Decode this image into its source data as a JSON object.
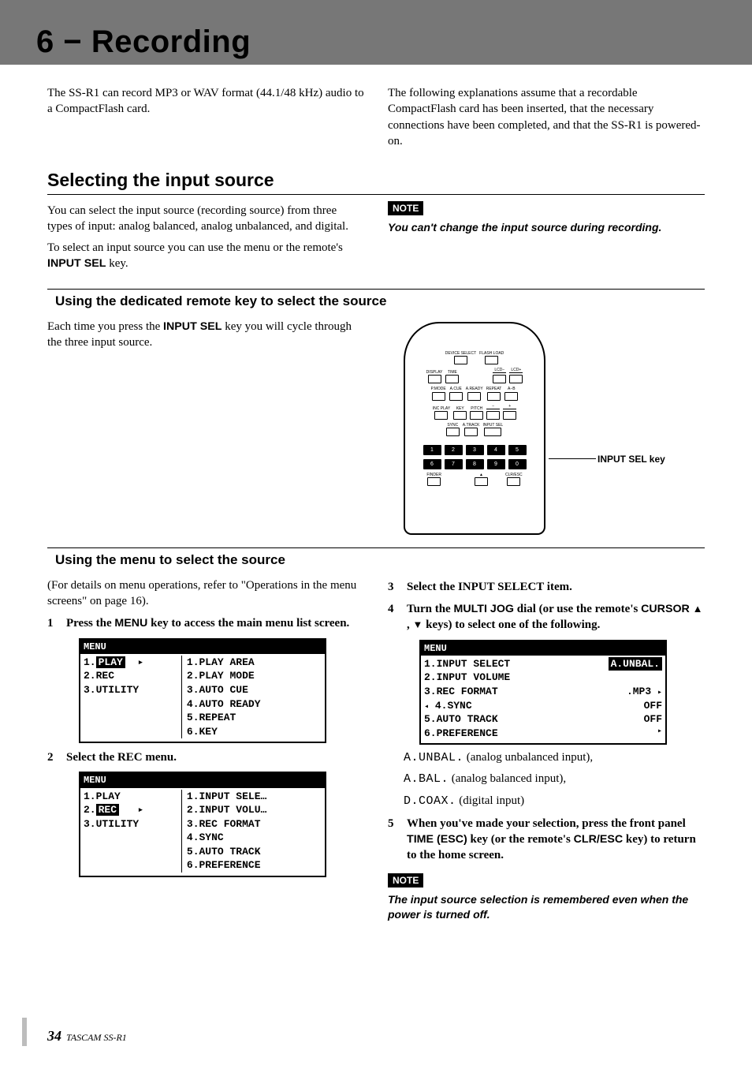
{
  "header": {
    "chapter_title": "6 − Recording"
  },
  "intro": {
    "left": "The SS-R1 can record MP3 or WAV format (44.1/48 kHz) audio to a CompactFlash card.",
    "right": "The following explanations assume that a recordable CompactFlash card has been inserted, that the necessary connections have been completed, and that the SS-R1 is powered-on."
  },
  "section1": {
    "title": "Selecting the input source",
    "p1": "You can select the input source (recording source) from three types of input: analog balanced, analog unbalanced, and digital.",
    "p2_a": "To select an input source you can use the menu or the remote's ",
    "p2_key": "INPUT SEL",
    "p2_b": " key.",
    "note_label": "NOTE",
    "note_text": "You can't change the input source during recording."
  },
  "sub1": {
    "title": "Using the dedicated remote key to select the source",
    "p1_a": "Each time you press the ",
    "p1_key": "INPUT SEL",
    "p1_b": " key you will cycle through the three input source.",
    "remote_callout": "INPUT SEL key",
    "remote_labels": {
      "r1": [
        "DEVICE SELECT",
        "FLASH LOAD"
      ],
      "r2": [
        "DISPLAY",
        "TIME",
        "",
        "LCD−",
        "LCD+"
      ],
      "r3": [
        "P.MODE",
        "A.CUE",
        "A.READY",
        "REPEAT",
        "A−B"
      ],
      "r4": [
        "INC PLAY",
        "KEY",
        "PITCH",
        "−",
        "+"
      ],
      "r5": [
        "SYNC",
        "A.TRACK",
        "INPUT SEL"
      ],
      "nums": [
        "1",
        "2",
        "3",
        "4",
        "5",
        "6",
        "7",
        "8",
        "9",
        "0"
      ],
      "bottom": [
        "FINDER",
        "",
        "",
        "",
        "CLR/ESC"
      ]
    }
  },
  "sub2": {
    "title": "Using the menu to select the source",
    "intro": "(For details on menu operations, refer to \"Operations in the menu screens\" on page 16).",
    "step1_a": "Press the ",
    "step1_key": "MENU",
    "step1_b": " key to access the main menu list screen.",
    "menu1": {
      "header": "MENU",
      "left": [
        "1.PLAY",
        "2.REC",
        "3.UTILITY"
      ],
      "left_selected_index": 0,
      "right": [
        "1.PLAY AREA",
        "2.PLAY MODE",
        "3.AUTO CUE",
        "4.AUTO READY",
        "5.REPEAT",
        "6.KEY"
      ]
    },
    "step2": "Select the REC menu.",
    "menu2": {
      "header": "MENU",
      "left": [
        "1.PLAY",
        "2.REC",
        "3.UTILITY"
      ],
      "left_selected_index": 1,
      "right": [
        "1.INPUT SELE…",
        "2.INPUT VOLU…",
        "3.REC FORMAT",
        "4.SYNC",
        "5.AUTO TRACK",
        "6.PREFERENCE"
      ]
    },
    "step3": "Select the INPUT SELECT item.",
    "step4_a": "Turn the ",
    "step4_key1": "MULTI JOG",
    "step4_b": " dial (or use the remote's ",
    "step4_key2": "CURSOR",
    "step4_c": "  ,   keys) to select one of the following.",
    "step4_up": "▲",
    "step4_dn": "▼",
    "menu3": {
      "header": "MENU",
      "items": [
        {
          "l": "1.INPUT SELECT",
          "r": "A.UNBAL.",
          "inv": true
        },
        {
          "l": "2.INPUT VOLUME",
          "r": ""
        },
        {
          "l": "3.REC FORMAT",
          "r": ".MP3"
        },
        {
          "l": "4.SYNC",
          "r": "OFF"
        },
        {
          "l": "5.AUTO TRACK",
          "r": "OFF"
        },
        {
          "l": "6.PREFERENCE",
          "r": ""
        }
      ]
    },
    "opts": {
      "o1_code": "A.UNBAL.",
      "o1_txt": " (analog unbalanced input),",
      "o2_code": "A.BAL.",
      "o2_txt": " (analog balanced input),",
      "o3_code": "D.COAX.",
      "o3_txt": " (digital input)"
    },
    "step5_a": "When you've made your selection, press the front panel ",
    "step5_key1": "TIME (ESC)",
    "step5_b": " key (or the remote's ",
    "step5_key2": "CLR/ESC",
    "step5_c": " key) to return to the home screen.",
    "note_label": "NOTE",
    "note_text": "The input source selection is remembered even when the power is turned off."
  },
  "footer": {
    "page": "34",
    "model": "TASCAM  SS-R1"
  }
}
